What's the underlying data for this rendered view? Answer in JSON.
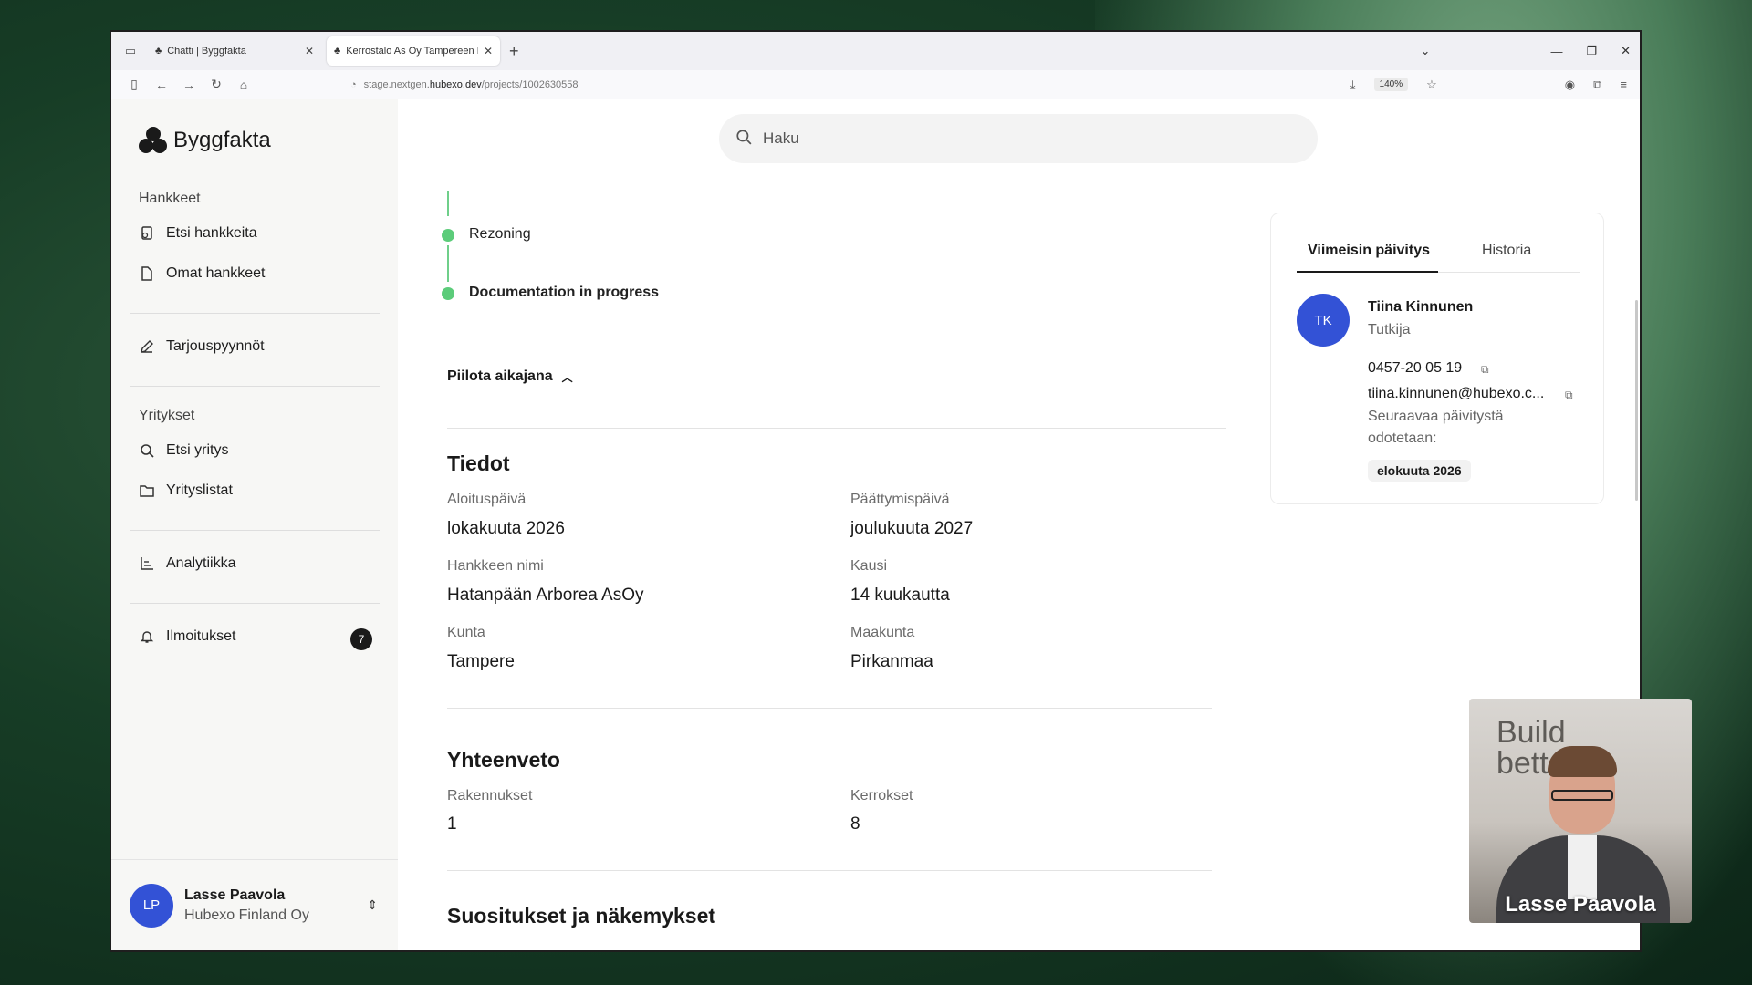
{
  "browser": {
    "tabs": [
      {
        "title": "Chatti | Byggfakta"
      },
      {
        "title": "Kerrostalo As Oy Tampereen H"
      }
    ],
    "url_prefix": "stage.nextgen.",
    "url_domain": "hubexo.dev",
    "url_path": "/projects/1002630558",
    "zoom": "140%"
  },
  "sidebar": {
    "brand": "Byggfakta",
    "section_projects": "Hankkeet",
    "items_projects": [
      {
        "label": "Etsi hankkeita",
        "icon": "search-doc-icon"
      },
      {
        "label": "Omat hankkeet",
        "icon": "document-icon"
      }
    ],
    "item_tenders": {
      "label": "Tarjouspyynnöt",
      "icon": "pencil-icon"
    },
    "section_companies": "Yritykset",
    "items_companies": [
      {
        "label": "Etsi yritys",
        "icon": "search-icon"
      },
      {
        "label": "Yrityslistat",
        "icon": "folder-icon"
      }
    ],
    "item_analytics": {
      "label": "Analytiikka",
      "icon": "chart-icon"
    },
    "item_notifications": {
      "label": "Ilmoitukset",
      "icon": "bell-icon",
      "badge": "7"
    },
    "user": {
      "initials": "LP",
      "name": "Lasse Paavola",
      "org": "Hubexo Finland Oy"
    }
  },
  "search": {
    "placeholder": "Haku"
  },
  "timeline": {
    "steps": [
      {
        "label": "Rezoning",
        "bold": false
      },
      {
        "label": "Documentation in progress",
        "bold": true
      }
    ],
    "toggle_label": "Piilota aikajana"
  },
  "details": {
    "title": "Tiedot",
    "fields": [
      {
        "label": "Aloituspäivä",
        "value": "lokakuuta 2026"
      },
      {
        "label": "Päättymispäivä",
        "value": "joulukuuta 2027"
      },
      {
        "label": "Hankkeen nimi",
        "value": "Hatanpään Arborea AsOy"
      },
      {
        "label": "Kausi",
        "value": "14 kuukautta"
      },
      {
        "label": "Kunta",
        "value": "Tampere"
      },
      {
        "label": "Maakunta",
        "value": "Pirkanmaa"
      }
    ]
  },
  "summary": {
    "title": "Yhteenveto",
    "fields": [
      {
        "label": "Rakennukset",
        "value": "1"
      },
      {
        "label": "Kerrokset",
        "value": "8"
      }
    ]
  },
  "recommendations": {
    "title": "Suositukset ja näkemykset"
  },
  "update_card": {
    "tab_latest": "Viimeisin päivitys",
    "tab_history": "Historia",
    "initials": "TK",
    "name": "Tiina Kinnunen",
    "role": "Tutkija",
    "phone": "0457-20 05 19",
    "email": "tiina.kinnunen@hubexo.c...",
    "next_update_text_1": "Seuraavaa päivitystä",
    "next_update_text_2": "odotetaan:",
    "next_update_date": "elokuuta 2026"
  },
  "webcam": {
    "wall_text_1": "Build",
    "wall_text_2": "bett",
    "presenter_name": "Lasse Paavola"
  },
  "colors": {
    "accent_blue": "#3352d6",
    "timeline_green": "#5ccc7a"
  }
}
